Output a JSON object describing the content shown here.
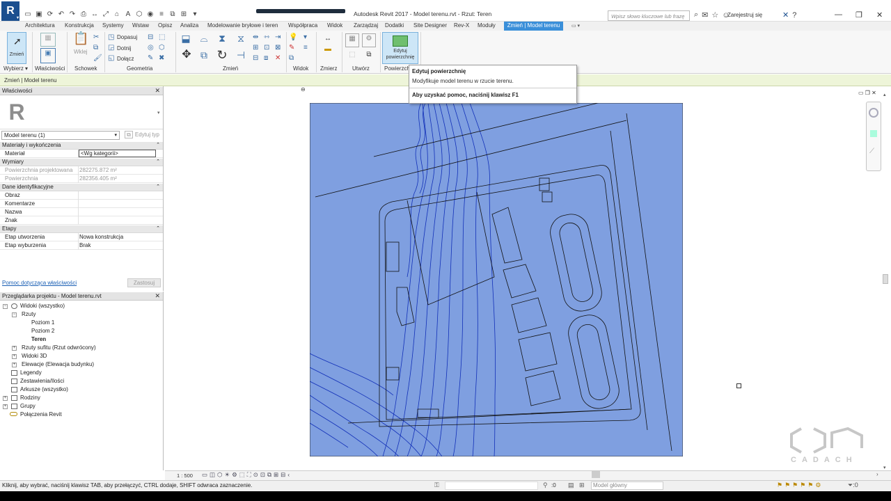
{
  "app": {
    "title_prefix": "Autodesk Revit 2017 - ",
    "title_doc": "Model terenu.rvt - Rzut: Teren",
    "search_placeholder": "Wpisz słowo kluczowe lub frazę",
    "sign_in": "Zarejestruj się",
    "help_icon": "?"
  },
  "ribbon": {
    "tabs": [
      "Architektura",
      "Konstrukcja",
      "Systemy",
      "Wstaw",
      "Opisz",
      "Analiza",
      "Modelowanie bryłowe i teren",
      "Współpraca",
      "Widok",
      "Zarządzaj",
      "Dodatki",
      "Site Designer",
      "Rev-X",
      "Moduły"
    ],
    "active_tab": "Zmień | Model terenu",
    "select_button": "Zmień",
    "paste_button": "Wklej",
    "edit_surface_button": "Edytuj powierzchnię",
    "geometry_items": [
      "Dopasuj",
      "Dotnij",
      "Dołącz"
    ],
    "panels": [
      "Wybierz",
      "Właściwości",
      "Schowek",
      "Geometria",
      "Zmień",
      "Widok",
      "Zmierz",
      "Utwórz",
      "Powierzch"
    ]
  },
  "tooltip": {
    "title": "Edytuj powierzchnię",
    "description": "Modyfikuje model terenu w rzucie terenu.",
    "help": "Aby uzyskać pomoc, naciśnij klawisz F1"
  },
  "context_bar": {
    "text": "Zmień | Model terenu"
  },
  "properties": {
    "title": "Właściwości",
    "type_name": "Model terenu (1)",
    "edit_type": "Edytuj typ",
    "categories": {
      "materials": "Materiały i wykończenia",
      "dimensions": "Wymiary",
      "identity": "Dane identyfikacyjne",
      "phasing": "Etapy"
    },
    "rows": {
      "material_key": "Materiał",
      "material_val": "<Wg kategorii>",
      "proj_area_key": "Powierzchnia projektowana",
      "proj_area_val": "282275.872 m²",
      "area_key": "Powierzchnia",
      "area_val": "282356.405 m²",
      "image_key": "Obraz",
      "comments_key": "Komentarze",
      "name_key": "Nazwa",
      "mark_key": "Znak",
      "phase_created_key": "Etap utworzenia",
      "phase_created_val": "Nowa konstrukcja",
      "phase_demolished_key": "Etap wyburzenia",
      "phase_demolished_val": "Brak"
    },
    "help_link": "Pomoc dotycząca właściwości",
    "apply": "Zastosuj"
  },
  "browser": {
    "title": "Przeglądarka projektu - Model terenu.rvt",
    "nodes": {
      "views": "Widoki (wszystko)",
      "floor_plans": "Rzuty",
      "level1": "Poziom 1",
      "level2": "Poziom 2",
      "site": "Teren",
      "ceiling_plans": "Rzuty sufitu (Rzut odwrócony)",
      "views3d": "Widoki 3D",
      "elevations": "Elewacje (Elewacja budynku)",
      "legends": "Legendy",
      "schedules": "Zestawienia/Ilości",
      "sheets": "Arkusze (wszystko)",
      "families": "Rodziny",
      "groups": "Grupy",
      "links": "Połączenia Revit"
    }
  },
  "view": {
    "scale": "1 : 500",
    "fill_color": "#7f9fe0",
    "contour_color": "#1230b8"
  },
  "status": {
    "text": "Kliknij, aby wybrać, naciśnij klawisz TAB, aby przełączyć, CTRL dodaje, SHIFT odwraca zaznaczenie.",
    "zero": ":0",
    "model": "Model główny"
  },
  "watermark": {
    "text": "CADACH"
  }
}
